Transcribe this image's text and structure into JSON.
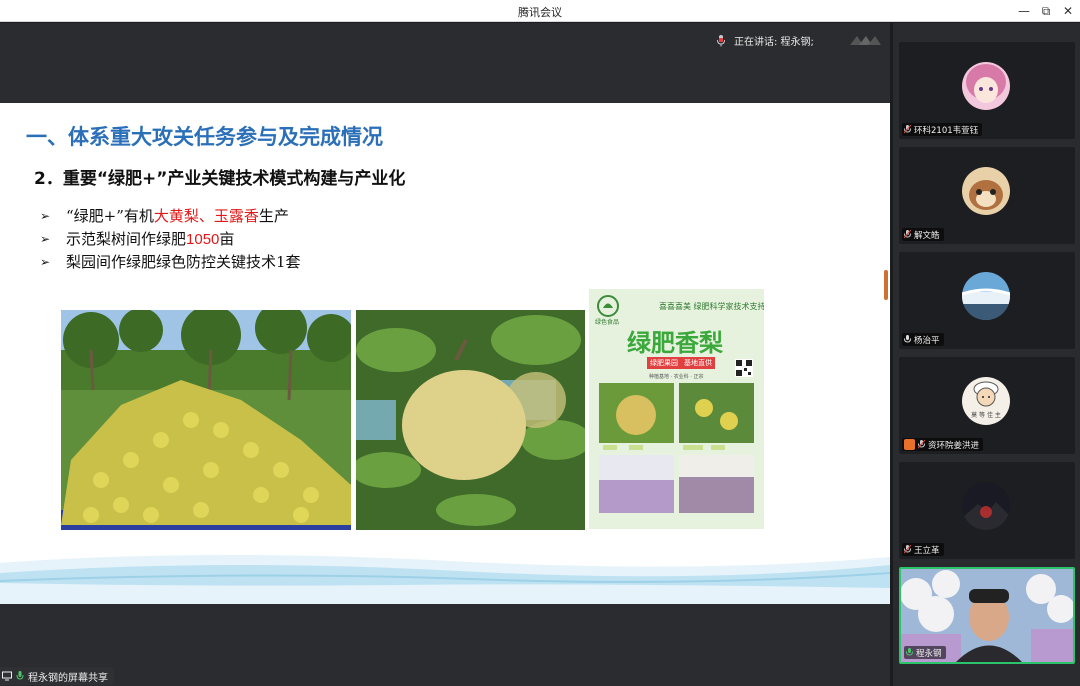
{
  "window": {
    "title": "腾讯会议",
    "controls": [
      "—",
      "⧉",
      "✕"
    ]
  },
  "meeting": {
    "speaking_label": "正在讲话: 程永钢;",
    "screen_share_label": "程永钢的屏幕共享"
  },
  "slide": {
    "title": "一、体系重大攻关任务参与及完成情况",
    "subtitle": "2．重要“绿肥+”产业关键技术模式构建与产业化",
    "bullets": [
      {
        "prefix": "“绿肥+”有机",
        "highlight": "大黄梨、玉露香",
        "suffix": "生产"
      },
      {
        "prefix": "示范梨树间作绿肥",
        "highlight": "1050",
        "suffix": "亩"
      },
      {
        "prefix": "梨园间作绿肥绿色防控关键技术1套",
        "highlight": "",
        "suffix": ""
      }
    ],
    "poster": {
      "header": "喜喜喜美 绿肥科学家技术支持",
      "brand": "绿色食品",
      "title": "绿肥香梨",
      "tags": [
        "绿肥果园",
        "基地直供"
      ],
      "footer": "种植基地 · 农业科 · 正宗"
    }
  },
  "participants": [
    {
      "name": "环科2101韦萱钰",
      "avatar": "anime-girl-avatar"
    },
    {
      "name": "解文皓",
      "avatar": "chipmunk-avatar"
    },
    {
      "name": "杨治平",
      "avatar": "waterfall-avatar"
    },
    {
      "name": "资环院姜洪进",
      "avatar": "cartoon-chef-avatar",
      "avatar_text": "莫 等 佳 主"
    },
    {
      "name": "王立革",
      "avatar": "night-landscape-avatar"
    },
    {
      "name": "程永钢",
      "avatar": "video-feed"
    }
  ],
  "colors": {
    "title_blue": "#2a6fb8",
    "highlight_red": "#e01818",
    "poster_green": "#4aa84a",
    "app_dark": "#2b2c2f"
  }
}
